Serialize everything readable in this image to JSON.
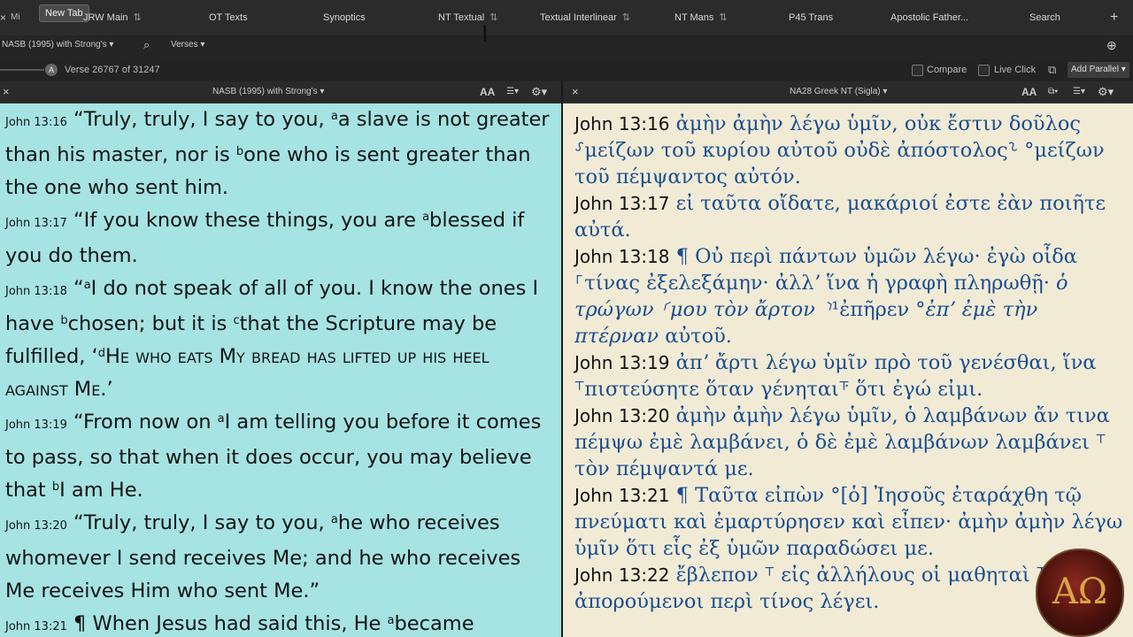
{
  "tabs": {
    "close_glyph": "×",
    "mini_label": "Mi",
    "newtab_tooltip": "New Tab",
    "items": [
      {
        "label": "JRW Main",
        "sort": "⇅"
      },
      {
        "label": "OT Texts",
        "sort": ""
      },
      {
        "label": "Synoptics",
        "sort": ""
      },
      {
        "label": "NT Textual",
        "sort": "⇅"
      },
      {
        "label": "Textual Interlinear",
        "sort": "⇅"
      },
      {
        "label": "NT Mans",
        "sort": "⇅"
      },
      {
        "label": "P45 Trans",
        "sort": ""
      },
      {
        "label": "Apostolic Father...",
        "sort": ""
      },
      {
        "label": "Search",
        "sort": ""
      }
    ],
    "plus": "+"
  },
  "toolbar": {
    "version": "NASB (1995) with Strong's",
    "search_glyph": "⌕",
    "mode": "Verses",
    "caret": "▾"
  },
  "status": {
    "avatar": "A",
    "verse_position": "Verse 26767 of 31247",
    "compare": "Compare",
    "live_click": "Live Click",
    "add_parallel": "Add Parallel"
  },
  "left_pane": {
    "title": "NASB (1995) with Strong's",
    "font_btn": "AA",
    "close": "×"
  },
  "right_pane": {
    "title": "NA28 Greek NT (Sigla)",
    "font_btn": "AA",
    "close": "×"
  },
  "nasb": {
    "v16_ref": "John 13:16",
    "v16_a": " “Truly, truly, I say to you, ",
    "v16_b": "a slave is not greater than his master, nor is ",
    "v16_c": "one who is sent greater than the one who sent him.",
    "v17_ref": "John 13:17",
    "v17_a": " “If you know these things, you are ",
    "v17_b": "blessed if you do them.",
    "v18_ref": "John 13:18",
    "v18_a": " “",
    "v18_b": "I do not speak of all of you. I know the ones I have ",
    "v18_c": "chosen; but it is ",
    "v18_d": "that the Scripture may be fulfilled, ‘",
    "v18_e": "He who eats My bread has lifted up his heel against Me.",
    "v18_f": "’",
    "v19_ref": "John 13:19",
    "v19_a": " “From now on ",
    "v19_b": "I am telling you before it comes to pass, so that when it does occur, you may believe that ",
    "v19_c": "I am He.",
    "v20_ref": "John 13:20",
    "v20_a": " “Truly, truly, I say to you, ",
    "v20_b": "he who receives whomever I send receives Me; and he who receives Me receives Him who sent Me.”",
    "v21_ref": "John 13:21",
    "v21_a": " ¶ When Jesus had said this, He ",
    "v21_b": "became",
    "sup_a": "a",
    "sup_b": "b",
    "sup_c": "c",
    "sup_d": "d"
  },
  "greek": {
    "v16_ref": "John 13:16",
    "v16": " ἀμὴν ἀμὴν λέγω ὑμῖν, οὐκ ἔστιν δοῦλος ⸉μείζων τοῦ κυρίου αὐτοῦ οὐδὲ ἀπόστολος⸊ °μείζων τοῦ πέμψαντος αὐτόν.",
    "v17_ref": "John 13:17",
    "v17": " εἰ ταῦτα οἴδατε, μακάριοί ἐστε ἐὰν ποιῆτε αὐτά.",
    "v18_ref": "John 13:18",
    "v18_a": " ¶  Οὐ περὶ πάντων ὑμῶν λέγω· ἐγὼ οἶδα ⸀τίνας ἐξελεξάμην· ἀλλʼ ἵνα ἡ γραφὴ πληρωθῇ· ",
    "v18_b": "ὁ τρώγων ⸂μου τὸν ἄρτον ⸃",
    "v18_c": "¹ἐπῆρεν °",
    "v18_d": "ἐπʼ ἐμὲ τὴν πτέρναν",
    "v18_e": " αὐτοῦ.",
    "v19_ref": "John 13:19",
    "v19": " ἀπʼ ἄρτι λέγω ὑμῖν πρὸ τοῦ γενέσθαι, ἵνα ⸆πιστεύσητε ὅταν γένηται⸇ ὅτι ἐγώ εἰμι.",
    "v20_ref": "John 13:20",
    "v20": " ἀμὴν ἀμὴν λέγω ὑμῖν, ὁ λαμβάνων ἄν τινα πέμψω ἐμὲ λαμβάνει, ὁ δὲ ἐμὲ λαμβάνων λαμβάνει ⸆ τὸν πέμψαντά με.",
    "v21_ref": "John 13:21",
    "v21": " ¶  Ταῦτα εἰπὼν °[ὁ] Ἰησοῦς ἐταράχθη τῷ πνεύματι καὶ ἐμαρτύρησεν καὶ εἶπεν· ἀμὴν ἀμὴν λέγω ὑμῖν ὅτι εἷς ἐξ ὑμῶν παραδώσει με.",
    "v22_ref": "John 13:22",
    "v22": " ἔβλεπον ⸆ εἰς ἀλλήλους οἱ μαθηταὶ ⸆ ἀπορούμενοι περὶ τίνος λέγει."
  },
  "logo": {
    "glyph": "AΩ"
  }
}
